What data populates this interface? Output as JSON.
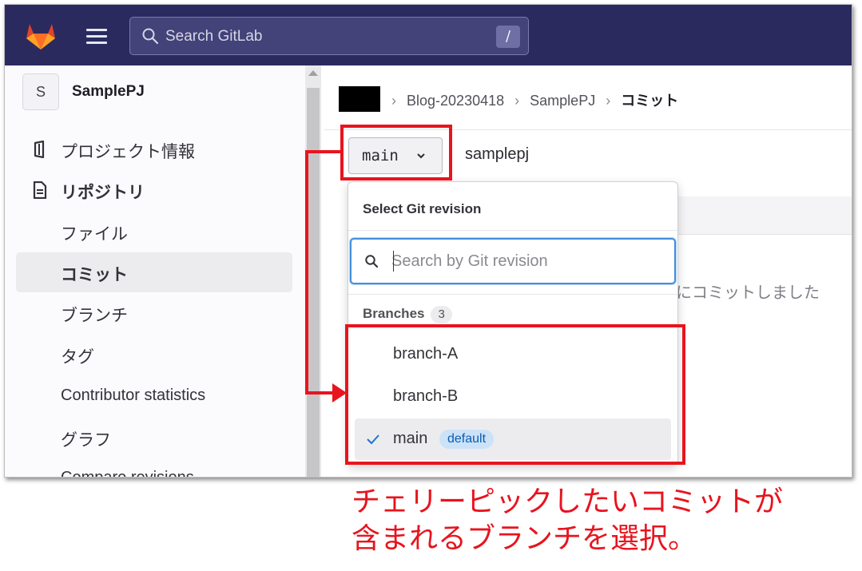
{
  "topbar": {
    "search_placeholder": "Search GitLab",
    "search_shortcut": "/",
    "logo_icon": "gitlab-tanuki-icon",
    "menu_icon": "hamburger-menu-icon",
    "bg_color": "#2b2a5f"
  },
  "sidebar": {
    "project_avatar": "S",
    "project_name": "SamplePJ",
    "items": [
      {
        "label": "プロジェクト情報",
        "icon": "project-info-icon"
      },
      {
        "label": "リポジトリ",
        "icon": "repository-document-icon"
      },
      {
        "label": "ファイル"
      },
      {
        "label": "コミット"
      },
      {
        "label": "ブランチ"
      },
      {
        "label": "タグ"
      },
      {
        "label": "Contributor statistics"
      },
      {
        "label": "グラフ"
      },
      {
        "label": "Compare revisions"
      }
    ]
  },
  "main": {
    "breadcrumb": [
      "Blog-20230418",
      "SamplePJ",
      "コミット"
    ],
    "revision_button": "main",
    "path_name": "samplepj",
    "background_commit_text": "にコミットしました"
  },
  "dropdown": {
    "title": "Select Git revision",
    "search_placeholder": "Search by Git revision",
    "branches_heading": "Branches",
    "branches_count": "3",
    "branches": [
      {
        "name": "branch-A"
      },
      {
        "name": "branch-B"
      },
      {
        "name": "main",
        "badge": "default"
      }
    ],
    "accent_color": "#428fdc"
  },
  "annotation": {
    "line1": "チェリーピックしたいコミットが",
    "line2": "含まれるブランチを選択。",
    "color": "#e8141e"
  }
}
